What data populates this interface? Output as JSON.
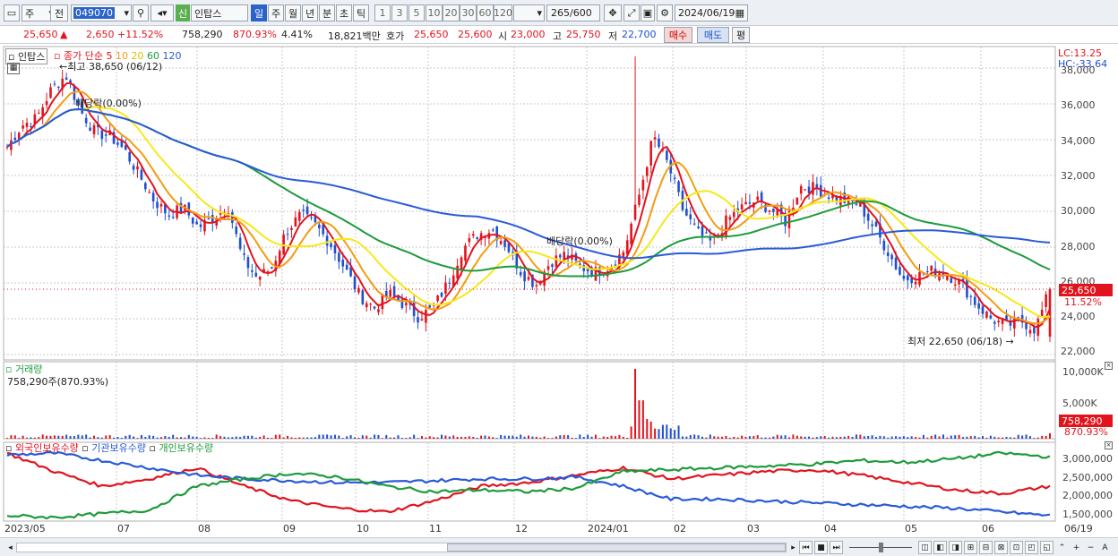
{
  "toolbar": {
    "period_type": "주",
    "prev_label": "전",
    "code": "049070",
    "market_badge": "신",
    "name": "인탑스",
    "tabs": [
      "일",
      "주",
      "월",
      "년",
      "분",
      "초",
      "틱"
    ],
    "active_tab": "일",
    "numbers": [
      "1",
      "3",
      "5",
      "10",
      "20",
      "30",
      "60",
      "120"
    ],
    "count": "265",
    "count_total": "/600",
    "date": "2024/06/19"
  },
  "quote": {
    "price": "25,650",
    "arrow": "▲",
    "change": "2,650",
    "change_pct": "+11.52%",
    "volume": "758,290",
    "volume_ratio": "870.93%",
    "turnover": "4.41%",
    "amount": "18,821백만",
    "ask_label": "호가",
    "ask": "25,650",
    "bid": "25,600",
    "open_label": "시",
    "open": "23,000",
    "high_label": "고",
    "high": "25,750",
    "low_label": "저",
    "low": "22,700",
    "buy_label": "매수",
    "sell_label": "매도",
    "eval_label": "평"
  },
  "price_pane": {
    "name": "인탑스",
    "close_label": "종가",
    "ma_label": "단순",
    "ma_periods": [
      "5",
      "10",
      "20",
      "60",
      "120"
    ],
    "ma_colors": [
      "#e1141e",
      "#f39c12",
      "#f7e81a",
      "#1e9b3c",
      "#2a5ad8"
    ],
    "high_note": "←최고 38,650 (06/12)",
    "low_note": "최저 22,650 (06/18) →",
    "div_note_1": "배당락(0.00%)",
    "div_note_2": "배당락(0.00%)",
    "lc": "LC:13.25",
    "hc": "HC:-33.64",
    "cur_price_tag": "25,650",
    "cur_pct_tag": "11.52%",
    "y_ticks": [
      "38,000",
      "36,000",
      "34,000",
      "32,000",
      "30,000",
      "28,000",
      "26,000",
      "24,000",
      "22,000"
    ]
  },
  "volume_pane": {
    "title": "거래량",
    "value": "758,290주(870.93%)",
    "y_ticks": [
      "10,000K",
      "5,000K"
    ],
    "tag_value": "758,290",
    "tag_pct": "870.93%"
  },
  "holding_pane": {
    "legend": [
      "외국인보유수량",
      "기관보유수량",
      "개인보유수량"
    ],
    "colors": [
      "#e1141e",
      "#2a5ad8",
      "#1e9b3c"
    ],
    "y_ticks": [
      "3,000,000",
      "2,500,000",
      "2,000,000",
      "1,500,000"
    ]
  },
  "x_axis": [
    "2023/05",
    "07",
    "08",
    "09",
    "10",
    "11",
    "12",
    "2024/01",
    "02",
    "03",
    "04",
    "05",
    "06",
    "06/19"
  ],
  "chart_data": {
    "type": "candlestick",
    "title": "인탑스",
    "x_labels": [
      "2023/05",
      "07",
      "08",
      "09",
      "10",
      "11",
      "12",
      "2024/01",
      "02",
      "03",
      "04",
      "05",
      "06"
    ],
    "y_range": [
      22000,
      38650
    ],
    "close_path": [
      33600,
      34800,
      35200,
      36800,
      37600,
      35600,
      34400,
      34200,
      33400,
      32000,
      30600,
      29800,
      30200,
      29100,
      29600,
      30400,
      27400,
      26300,
      26800,
      28900,
      29800,
      29200,
      28200,
      26800,
      25300,
      24600,
      25400,
      24800,
      24100,
      24600,
      26000,
      27900,
      28700,
      29000,
      28100,
      26600,
      25900,
      27200,
      27600,
      26900,
      26600,
      26900,
      27800,
      30800,
      34200,
      32600,
      30100,
      28800,
      28200,
      29500,
      30200,
      30600,
      30100,
      29400,
      31400,
      31300,
      30900,
      30600,
      30400,
      29100,
      27700,
      26200,
      26400,
      26700,
      26500,
      25900,
      24800,
      24000,
      23600,
      23900,
      23400,
      25650
    ],
    "last_close": 25650,
    "high": {
      "value": 38650,
      "date": "06/12"
    },
    "low": {
      "value": 22650,
      "date": "06/18"
    },
    "ma_periods": [
      5,
      10,
      20,
      60,
      120
    ],
    "volume_last": 758290,
    "volume_ratio_pct": 870.93,
    "holding_series": [
      "외국인보유수량",
      "기관보유수량",
      "개인보유수량"
    ],
    "holding_range": [
      1400000,
      3300000
    ]
  }
}
